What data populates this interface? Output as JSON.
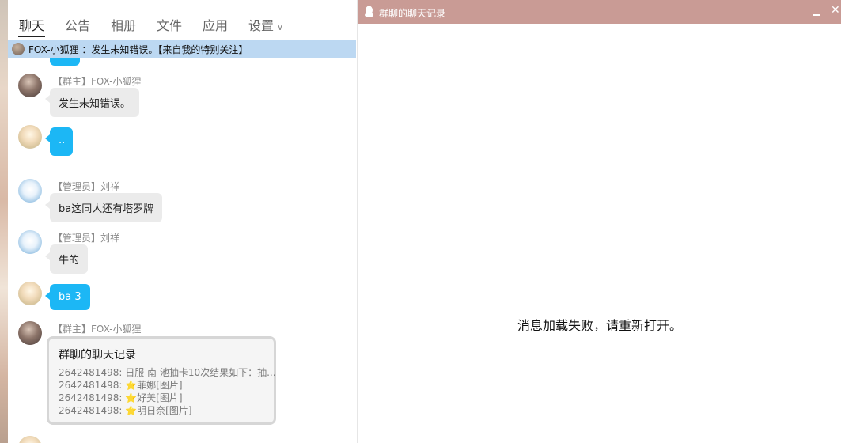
{
  "chat": {
    "tabs": [
      {
        "label": "聊天"
      },
      {
        "label": "公告"
      },
      {
        "label": "相册"
      },
      {
        "label": "文件"
      },
      {
        "label": "应用"
      },
      {
        "label": "设置"
      }
    ],
    "notice": "FOX-小狐狸 ：发生未知错误。【来自我的特别关注】",
    "messages": [
      {
        "sender": "【群主】FOX-小狐狸",
        "text": "发生未知错误。"
      },
      {
        "text": ".."
      },
      {
        "sender": "【管理员】刘祥",
        "text": "ba这同人还有塔罗牌"
      },
      {
        "sender": "【管理员】刘祥",
        "text": "牛的"
      },
      {
        "text": "ba 3"
      },
      {
        "sender": "【群主】FOX-小狐狸"
      }
    ],
    "forward": {
      "title": "群聊的聊天记录",
      "lines": [
        "2642481498: 日服 南 池抽卡10次结果如下：抽...",
        "2642481498: ",
        "菲娜[图片]",
        "2642481498: ",
        "好美[图片]",
        "2642481498: ",
        "明日奈[图片]"
      ]
    }
  },
  "history": {
    "title": "群聊的聊天记录",
    "error": "消息加载失败，请重新打开。"
  },
  "colors": {
    "accent_blue": "#1cb7f5",
    "notice_bg": "#bcd8f2",
    "titlebar": "#c99b95"
  }
}
